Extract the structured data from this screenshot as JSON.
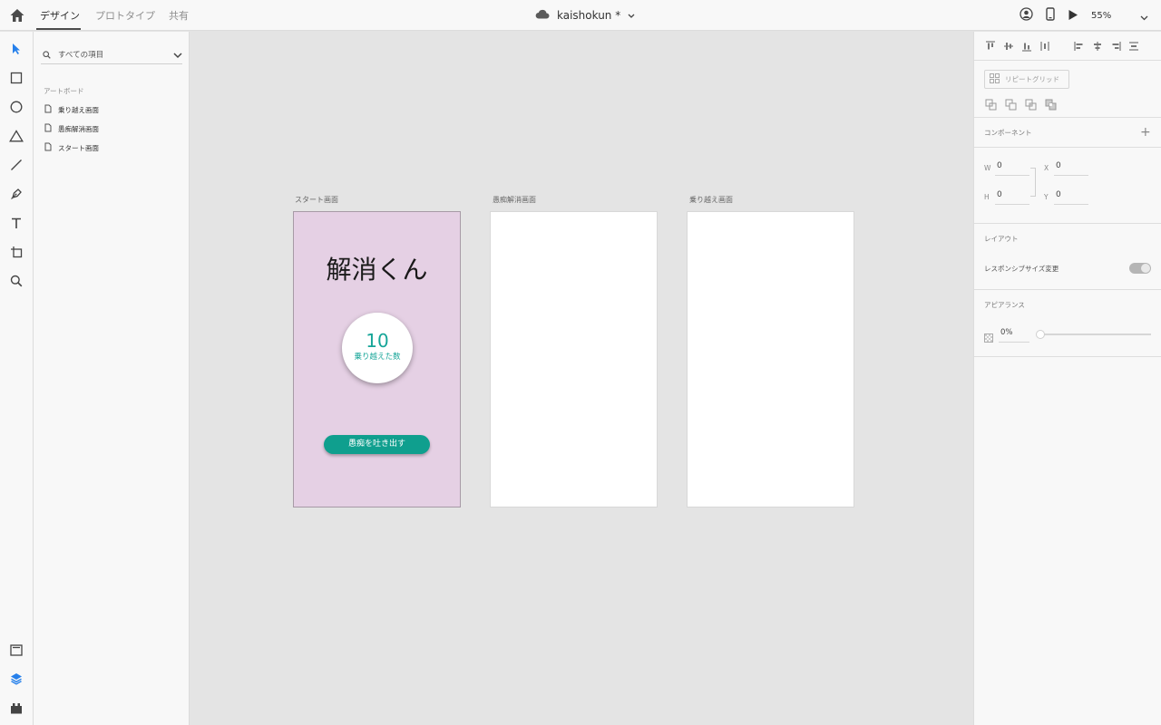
{
  "topbar": {
    "tabs": [
      {
        "label": "デザイン",
        "active": true
      },
      {
        "label": "プロトタイプ",
        "active": false
      },
      {
        "label": "共有",
        "active": false
      }
    ],
    "doc_name": "kaishokun *",
    "zoom": "55%"
  },
  "layers": {
    "search_text": "すべての項目",
    "section": "アートボード",
    "items": [
      "乗り越え画面",
      "愚痴解消画面",
      "スタート画面"
    ]
  },
  "canvas": {
    "artboards": [
      {
        "label": "スタート画面"
      },
      {
        "label": "愚痴解消画面"
      },
      {
        "label": "乗り越え画面"
      }
    ],
    "start_screen": {
      "title": "解消くん",
      "count": "10",
      "count_label": "乗り越えた数",
      "button_label": "愚痴を吐き出す",
      "bg_color": "#e5d0e4",
      "accent_color": "#0f9f8e"
    }
  },
  "props": {
    "repeat_grid": "リピートグリッド",
    "component": "コンポーネント",
    "w_label": "W",
    "w": "0",
    "h_label": "H",
    "h": "0",
    "x_label": "X",
    "x": "0",
    "y_label": "Y",
    "y": "0",
    "layout": "レイアウト",
    "responsive": "レスポンシブサイズ変更",
    "responsive_on": true,
    "appearance": "アピアランス",
    "opacity": "0%"
  }
}
